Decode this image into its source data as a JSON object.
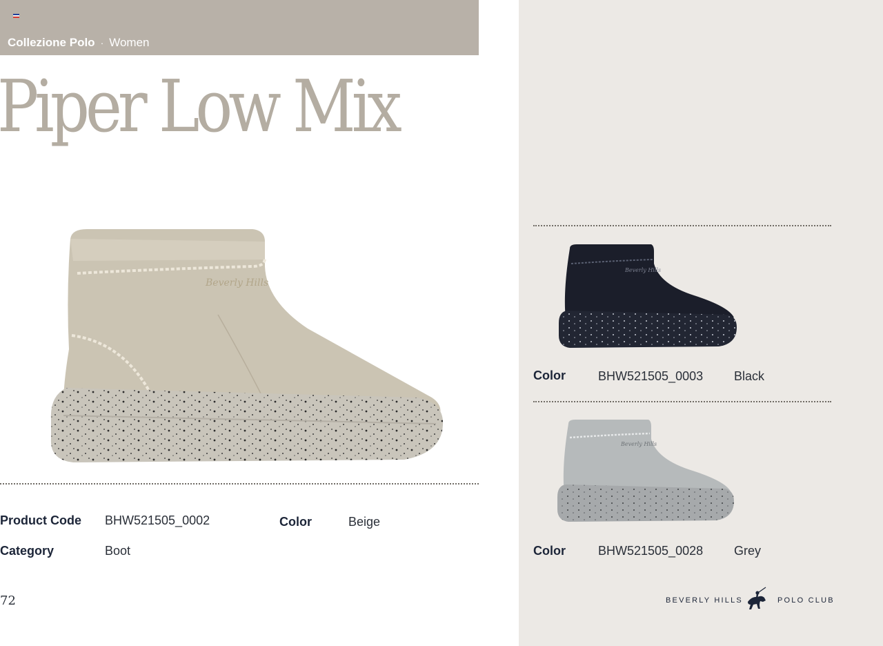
{
  "header": {
    "collection": "Collezione Polo",
    "separator": "·",
    "segment": "Women"
  },
  "product": {
    "title": "Piper Low Mix",
    "product_code_label": "Product Code",
    "product_code": "BHW521505_0002",
    "color_label": "Color",
    "color": "Beige",
    "category_label": "Category",
    "category": "Boot"
  },
  "variants": [
    {
      "color_label": "Color",
      "code": "BHW521505_0003",
      "color": "Black"
    },
    {
      "color_label": "Color",
      "code": "BHW521505_0028",
      "color": "Grey"
    }
  ],
  "page_number": "72",
  "brand": {
    "left": "BEVERLY HILLS",
    "right": "POLO CLUB",
    "logo_icon": "polo-player-icon"
  },
  "colors": {
    "header_band": "#b8b1a8",
    "title": "#b4ada2",
    "right_panel": "#ece9e5",
    "label": "#1c2538",
    "beige_boot": "#cbc4b3",
    "black_boot": "#1b1e2a",
    "grey_boot": "#b6babb"
  }
}
